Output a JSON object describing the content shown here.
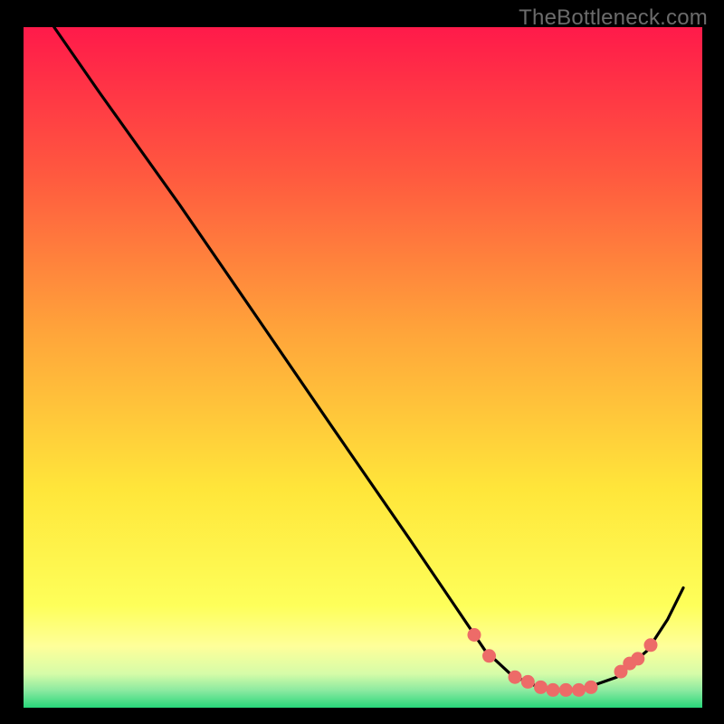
{
  "watermark": "TheBottleneck.com",
  "colors": {
    "black": "#000000",
    "curve": "#000000",
    "dot": "#ed6b68",
    "gradient_top": "#ff1a4a",
    "gradient_mid1": "#ff8a3a",
    "gradient_mid2": "#ffe63a",
    "gradient_yellowpale": "#feff9a",
    "gradient_greenpale": "#baf7b0",
    "gradient_green": "#28d77a"
  },
  "chart_data": {
    "type": "line",
    "title": "",
    "xlabel": "",
    "ylabel": "",
    "xlim": [
      0,
      100
    ],
    "ylim": [
      0,
      100
    ],
    "legend": false,
    "note": "Y is bottleneck %, X is relative component strength. Values estimated from pixel positions; no axis ticks are visible.",
    "curve": [
      {
        "x": 4.5,
        "y": 100
      },
      {
        "x": 11.1,
        "y": 90.5
      },
      {
        "x": 23.0,
        "y": 73.9
      },
      {
        "x": 34.3,
        "y": 57.5
      },
      {
        "x": 45.5,
        "y": 41.2
      },
      {
        "x": 56.8,
        "y": 24.9
      },
      {
        "x": 63.6,
        "y": 14.9
      },
      {
        "x": 68.0,
        "y": 8.4
      },
      {
        "x": 71.8,
        "y": 4.9
      },
      {
        "x": 74.9,
        "y": 3.4
      },
      {
        "x": 78.0,
        "y": 2.6
      },
      {
        "x": 81.1,
        "y": 2.6
      },
      {
        "x": 84.3,
        "y": 3.4
      },
      {
        "x": 87.4,
        "y": 4.5
      },
      {
        "x": 91.9,
        "y": 8.4
      },
      {
        "x": 94.9,
        "y": 13.0
      },
      {
        "x": 97.2,
        "y": 17.6
      }
    ],
    "points": [
      {
        "x": 66.4,
        "y": 10.7
      },
      {
        "x": 68.6,
        "y": 7.6
      },
      {
        "x": 72.4,
        "y": 4.5
      },
      {
        "x": 74.3,
        "y": 3.8
      },
      {
        "x": 76.2,
        "y": 3.0
      },
      {
        "x": 78.0,
        "y": 2.6
      },
      {
        "x": 79.9,
        "y": 2.6
      },
      {
        "x": 81.8,
        "y": 2.6
      },
      {
        "x": 83.6,
        "y": 3.0
      },
      {
        "x": 88.0,
        "y": 5.3
      },
      {
        "x": 89.3,
        "y": 6.5
      },
      {
        "x": 90.5,
        "y": 7.2
      },
      {
        "x": 92.4,
        "y": 9.2
      }
    ]
  }
}
